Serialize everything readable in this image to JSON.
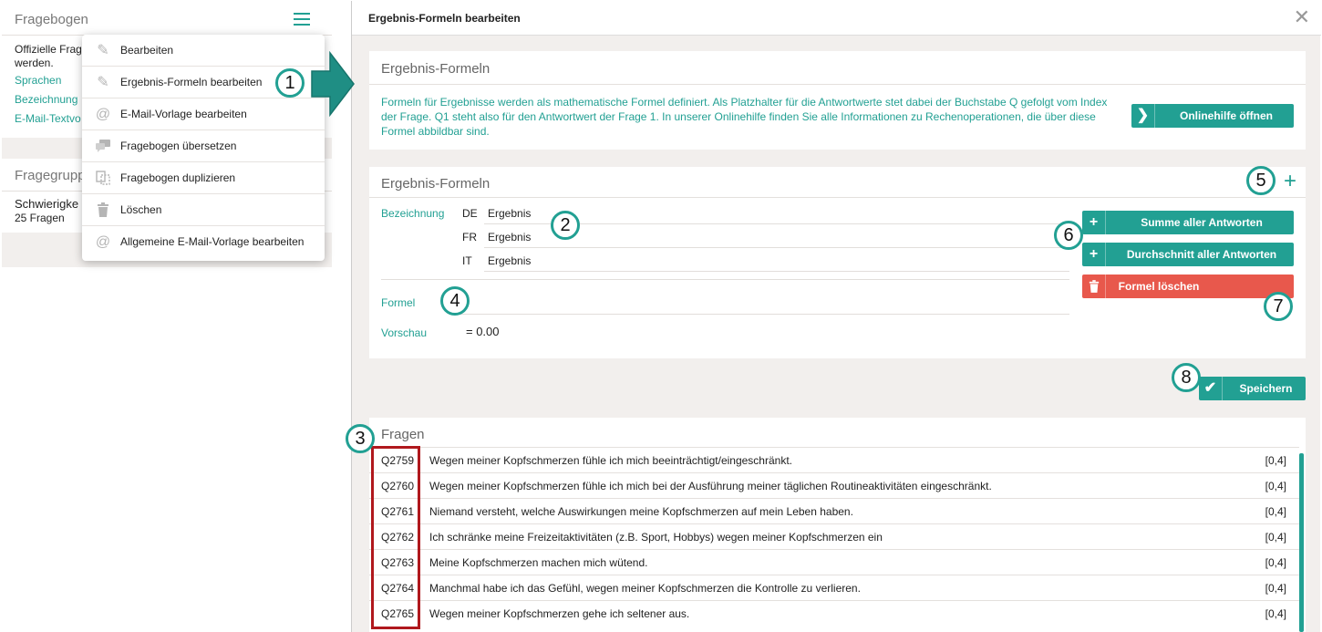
{
  "left_page": {
    "card1": {
      "title": "Fragebogen",
      "description": "Offizielle Frag… werden.",
      "desc_line1": "Offizielle Frag",
      "desc_line2": "werden.",
      "links": [
        "Sprachen",
        "Bezeichnung",
        "E-Mail-Textvo"
      ]
    },
    "card2": {
      "title": "Fragegrupp",
      "group_name": "Schwierigke",
      "group_count": "25 Fragen"
    }
  },
  "menu": {
    "items": [
      {
        "label": "Bearbeiten",
        "icon": "pencil-icon"
      },
      {
        "label": "Ergebnis-Formeln bearbeiten",
        "icon": "pencil-icon"
      },
      {
        "label": "E-Mail-Vorlage bearbeiten",
        "icon": "at-icon"
      },
      {
        "label": "Fragebogen übersetzen",
        "icon": "speech-bubbles-icon"
      },
      {
        "label": "Fragebogen duplizieren",
        "icon": "duplicate-icon"
      },
      {
        "label": "Löschen",
        "icon": "trash-icon"
      },
      {
        "label": "Allgemeine E-Mail-Vorlage bearbeiten",
        "icon": "at-icon"
      }
    ]
  },
  "callouts": [
    "1",
    "2",
    "3",
    "4",
    "5",
    "6",
    "7",
    "8"
  ],
  "dialog": {
    "title": "Ergebnis-Formeln bearbeiten",
    "close": "✕",
    "info_panel": {
      "title": "Ergebnis-Formeln",
      "text": "Formeln für Ergebnisse werden als mathematische Formel definiert. Als Platzhalter für die Antwortwerte stet dabei der Buchstabe Q gefolgt vom Index der Frage. Q1 steht also für den Antwortwert der Frage 1. In unserer Onlinehilfe finden Sie alle Informationen zu Rechenoperationen, die über diese Formel abbildbar sind.",
      "help_button": "Onlinehilfe öffnen"
    },
    "formula_panel": {
      "title": "Ergebnis-Formeln",
      "add": "+",
      "bezeichnung_label": "Bezeichnung",
      "names": [
        {
          "lang": "DE",
          "value": "Ergebnis"
        },
        {
          "lang": "FR",
          "value": "Ergebnis"
        },
        {
          "lang": "IT",
          "value": "Ergebnis"
        }
      ],
      "formel_label": "Formel",
      "formel_value": "",
      "vorschau_label": "Vorschau",
      "vorschau_value": "= 0.00",
      "btn_sum": "Summe aller Antworten",
      "btn_avg": "Durchschnitt aller Antworten",
      "btn_delete": "Formel löschen"
    },
    "save_button": "Speichern",
    "questions": {
      "title": "Fragen",
      "rows": [
        {
          "id": "Q2759",
          "text": "Wegen meiner Kopfschmerzen fühle ich mich beeinträchtigt/eingeschränkt.",
          "range": "[0,4]"
        },
        {
          "id": "Q2760",
          "text": "Wegen meiner Kopfschmerzen fühle ich mich bei der Ausführung meiner täglichen Routineaktivitäten eingeschränkt.",
          "range": "[0,4]"
        },
        {
          "id": "Q2761",
          "text": "Niemand versteht, welche Auswirkungen meine Kopfschmerzen auf mein Leben haben.",
          "range": "[0,4]"
        },
        {
          "id": "Q2762",
          "text": "Ich schränke meine Freizeitaktivitäten (z.B. Sport, Hobbys) wegen meiner Kopfschmerzen ein",
          "range": "[0,4]"
        },
        {
          "id": "Q2763",
          "text": "Meine Kopfschmerzen machen mich wütend.",
          "range": "[0,4]"
        },
        {
          "id": "Q2764",
          "text": "Manchmal habe ich das Gefühl, wegen meiner Kopfschmerzen die Kontrolle zu verlieren.",
          "range": "[0,4]"
        },
        {
          "id": "Q2765",
          "text": "Wegen meiner Kopfschmerzen gehe ich seltener aus.",
          "range": "[0,4]"
        }
      ]
    }
  },
  "colors": {
    "accent": "#22a093",
    "danger": "#e8584c",
    "highlight_box": "#b0181d"
  }
}
